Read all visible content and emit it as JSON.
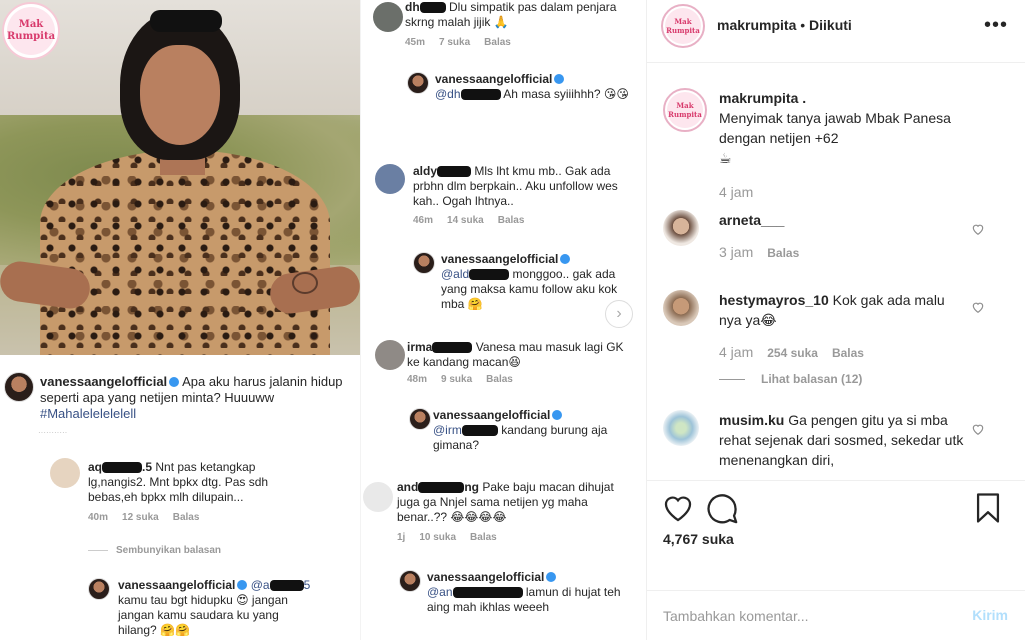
{
  "collage": {
    "watermark": "Mak Rumpita",
    "caption": {
      "username": "vanessaangelofficial",
      "text": "Apa aku harus jalanin hidup seperti apa yang netijen minta? Huuuww",
      "hashtag": "#Mahalelelelelell"
    },
    "left_comments": [
      {
        "user": "aq",
        "user_suffix": ".5",
        "text": "Nnt pas ketangkap lg,nangis2. Mnt bpkx dtg. Pas sdh bebas,eh bpkx mlh dilupain...",
        "time": "40m",
        "likes": "12 suka",
        "reply": "Balas"
      },
      {
        "hide": "Sembunyikan balasan"
      },
      {
        "user": "vanessaangelofficial",
        "mention": "@a",
        "mention_suffix": "5",
        "text": "kamu tau bgt hidupku 😍 jangan jangan kamu saudara ku yang hilang? 🤗🤗"
      }
    ],
    "right_comments": [
      {
        "user": "dh",
        "text": "Dlu simpatik pas dalam penjara skrng malah jijik 🙏",
        "time": "45m",
        "likes": "7 suka",
        "reply": "Balas"
      },
      {
        "user": "vanessaangelofficial",
        "mention": "@dh",
        "text": "Ah masa syiiihhh? 😘😘"
      },
      {
        "user": "aldy",
        "text": "Mls lht kmu mb.. Gak ada prbhn dlm berpkain.. Aku unfollow wes kah.. Ogah lhtnya..",
        "time": "46m",
        "likes": "14 suka",
        "reply": "Balas"
      },
      {
        "user": "vanessaangelofficial",
        "mention": "@ald",
        "text": "monggoo.. gak ada yang maksa kamu follow aku kok mba 🤗"
      },
      {
        "user": "irma",
        "text": "Vanesa mau masuk lagi GK ke kandang macan😆",
        "time": "48m",
        "likes": "9 suka",
        "reply": "Balas"
      },
      {
        "user": "vanessaangelofficial",
        "mention": "@irm",
        "text": "kandang burung aja gimana?"
      },
      {
        "user": "and",
        "user_suffix": "ng",
        "text": "Pake baju macan dihujat juga ga Nnjel sama netijen yg maha benar..?? 😂😂😂😂",
        "time": "1j",
        "likes": "10 suka",
        "reply": "Balas"
      },
      {
        "user": "vanessaangelofficial",
        "mention": "@an",
        "text": "lamun di hujat teh aing mah ikhlas weeeh"
      }
    ]
  },
  "sidebar": {
    "header": {
      "username": "makrumpita",
      "separator": " • ",
      "follow_status": "Diikuti",
      "more": "•••",
      "avatar_text": "Mak Rumpita"
    },
    "caption": {
      "username": "makrumpita .",
      "text": "Menyimak tanya jawab Mbak Panesa dengan netijen +62",
      "emoji": "☕",
      "time": "4 jam"
    },
    "comments": [
      {
        "username": "arneta___",
        "text": "",
        "time": "3 jam",
        "likes": "",
        "reply": "Balas"
      },
      {
        "username": "hestymayros_10",
        "text": "Kok gak ada malu nya ya😂",
        "time": "4 jam",
        "likes": "254 suka",
        "reply": "Balas",
        "view_replies": "Lihat balasan (12)"
      },
      {
        "username": "musim.ku",
        "text": "Ga pengen gitu ya si mba rehat sejenak dari sosmed, sekedar utk menenangkan diri,",
        "time": "",
        "likes": "",
        "reply": ""
      }
    ],
    "like_count": "4,767 suka",
    "comment_input": {
      "placeholder": "Tambahkan komentar...",
      "post_label": "Kirim"
    }
  }
}
